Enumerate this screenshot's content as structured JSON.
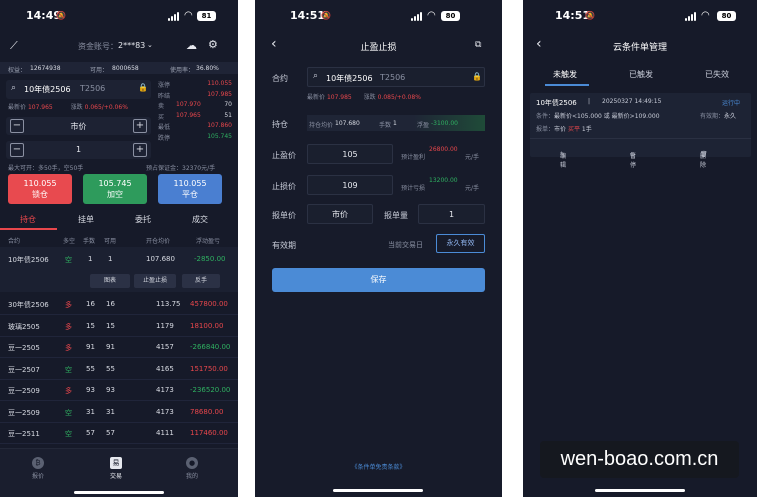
{
  "phone1": {
    "status": {
      "time": "14:49",
      "battery": "81"
    },
    "header": {
      "account_label": "资金账号：",
      "account_value": "2***83"
    },
    "acct_bar": {
      "equity_label": "权益：",
      "equity": "12674938",
      "available_label": "可用：",
      "available": "8000658",
      "usage_label": "使用率：",
      "usage": "36.80%"
    },
    "search": {
      "name": "10年债2506",
      "code": "T2506",
      "latest_label": "最新价",
      "latest": "107.965",
      "change_label": "涨跌",
      "change": "0.065/+0.06%"
    },
    "quotes": [
      {
        "label": "涨停",
        "value": "110.055",
        "color": "red"
      },
      {
        "label": "昨结",
        "value": "107.985",
        "color": "red"
      },
      {
        "label": "卖",
        "value": "107.970",
        "qty": "70",
        "color": "red"
      },
      {
        "label": "买",
        "value": "107.965",
        "qty": "51",
        "color": "red"
      },
      {
        "label": "最低",
        "value": "107.860",
        "color": "red"
      },
      {
        "label": "跌停",
        "value": "105.745",
        "color": "green"
      }
    ],
    "price_type": "市价",
    "quantity": "1",
    "max_open": "最大可开：多50手，空50手",
    "margin": "预占保证金：32370元/手",
    "buttons": [
      {
        "price": "110.055",
        "label": "锁仓"
      },
      {
        "price": "105.745",
        "label": "加空"
      },
      {
        "price": "110.055",
        "label": "平仓"
      }
    ],
    "tabs": [
      "持仓",
      "挂单",
      "委托",
      "成交"
    ],
    "table_head": [
      "合约",
      "多空",
      "手数",
      "可用",
      "开仓均价",
      "浮动盈亏"
    ],
    "selected_row": {
      "name": "10年债2506",
      "dir": "空",
      "lots": "1",
      "avail": "1",
      "avg": "107.680",
      "pnl": "-2850.00"
    },
    "row_actions": [
      "图表",
      "止盈止损",
      "反手"
    ],
    "rows": [
      {
        "name": "30年债2506",
        "dir": "多",
        "lots": "16",
        "avail": "16",
        "avg": "113.75",
        "pnl": "457800.00",
        "up": true
      },
      {
        "name": "玻璃2505",
        "dir": "多",
        "lots": "15",
        "avail": "15",
        "avg": "1179",
        "pnl": "18100.00",
        "up": true
      },
      {
        "name": "豆一2505",
        "dir": "多",
        "lots": "91",
        "avail": "91",
        "avg": "4157",
        "pnl": "-266840.00",
        "up": false
      },
      {
        "name": "豆一2507",
        "dir": "空",
        "lots": "55",
        "avail": "55",
        "avg": "4165",
        "pnl": "151750.00",
        "up": true
      },
      {
        "name": "豆一2509",
        "dir": "多",
        "lots": "93",
        "avail": "93",
        "avg": "4173",
        "pnl": "-236520.00",
        "up": false
      },
      {
        "name": "豆一2509",
        "dir": "空",
        "lots": "31",
        "avail": "31",
        "avg": "4173",
        "pnl": "78680.00",
        "up": true
      },
      {
        "name": "豆一2511",
        "dir": "空",
        "lots": "57",
        "avail": "57",
        "avg": "4111",
        "pnl": "117460.00",
        "up": true
      }
    ],
    "tabbar": [
      "报价",
      "交易",
      "我的"
    ]
  },
  "phone2": {
    "status": {
      "time": "14:51",
      "battery": "80"
    },
    "title": "止盈止损",
    "contract_label": "合约",
    "contract_name": "10年债2506",
    "contract_code": "T2506",
    "latest_label": "最新价",
    "latest": "107.985",
    "change_label": "涨跌",
    "change": "0.085/+0.08%",
    "position_label": "持仓",
    "position_avg_label": "持仓均价",
    "position_avg": "107.680",
    "position_lots_label": "手数",
    "position_lots": "1",
    "position_pnl_label": "浮盈",
    "position_pnl": "-3100.00",
    "tp_label": "止盈价",
    "tp_value": "105",
    "tp_est_label": "预计盈利",
    "tp_est": "26800.00",
    "tp_unit": "元/手",
    "sl_label": "止损价",
    "sl_value": "109",
    "sl_est_label": "预计亏损",
    "sl_est": "13200.00",
    "sl_unit": "元/手",
    "order_price_label": "报单价",
    "order_price_value": "市价",
    "order_qty_label": "报单量",
    "order_qty_value": "1",
    "validity_label": "有效期",
    "validity_opt1": "当前交易日",
    "validity_opt2": "永久有效",
    "save": "保存",
    "terms": "《条件单免责条款》"
  },
  "phone3": {
    "status": {
      "time": "14:51",
      "battery": "80"
    },
    "title": "云条件单管理",
    "tabs": [
      "未触发",
      "已触发",
      "已失效"
    ],
    "card": {
      "name": "10年债2506",
      "time": "20250327 14:49:15",
      "status": "运行中",
      "cond_label": "条件：",
      "cond": "最新价<105.000 或 最新价>109.000",
      "valid_label": "有效期：",
      "valid": "永久",
      "order_label": "报单：",
      "order_price": "市价",
      "order_side": "买平",
      "order_qty": "1手",
      "actions": [
        "编辑",
        "暂停",
        "删除"
      ]
    }
  },
  "watermark": "wen-boao.com.cn"
}
